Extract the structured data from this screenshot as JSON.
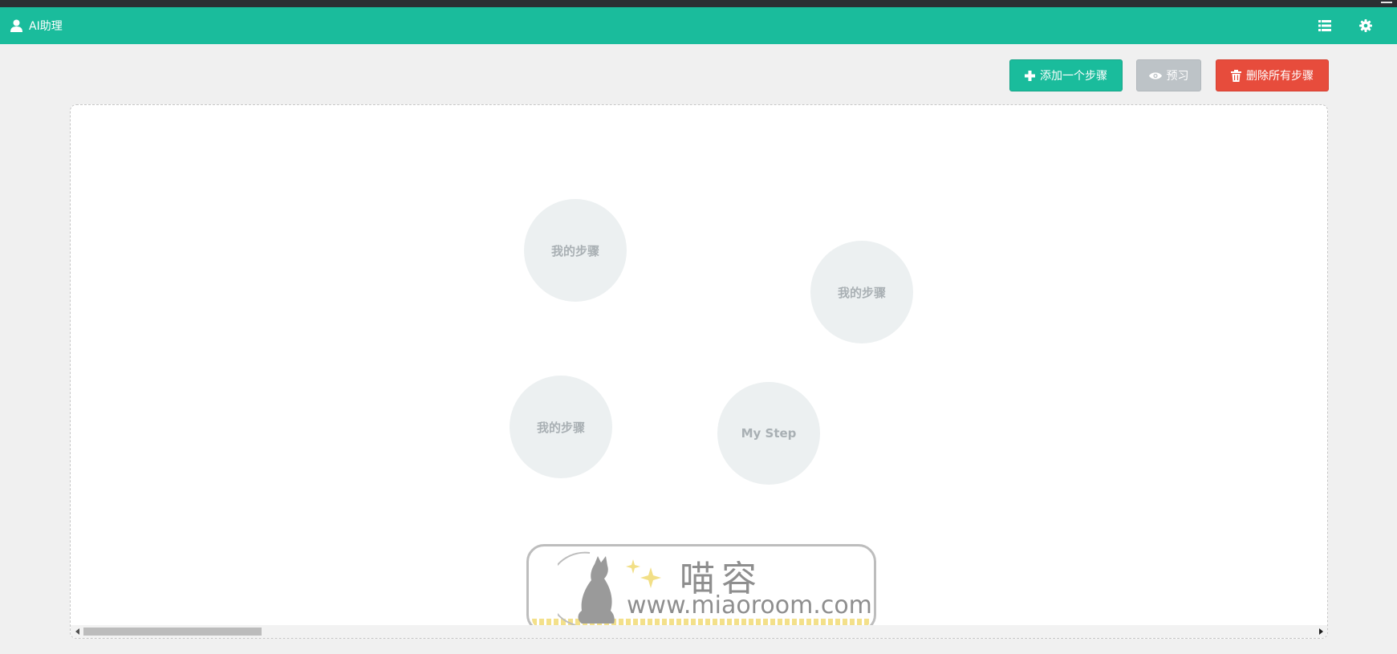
{
  "header": {
    "title": "AI助理",
    "user_icon": "user-icon",
    "list_icon": "list-icon",
    "settings_icon": "gear-icon"
  },
  "toolbar": {
    "add_step_label": "添加一个步骤",
    "preview_label": "预习",
    "delete_all_label": "删除所有步骤",
    "add_icon": "plus-icon",
    "preview_icon": "eye-icon",
    "delete_icon": "trash-icon"
  },
  "canvas": {
    "steps": [
      {
        "label": "我的步骤"
      },
      {
        "label": "我的步骤"
      },
      {
        "label": "我的步骤"
      },
      {
        "label": "My Step"
      }
    ]
  },
  "watermark": {
    "name": "喵容",
    "url": "www.miaoroom.com"
  },
  "colors": {
    "header": "#1abc9c",
    "add_button": "#1abc9c",
    "preview_button": "#bdc3c7",
    "delete_button": "#e74c3c",
    "step_fill": "#ecf0f1",
    "step_text": "#a9b0b4"
  }
}
